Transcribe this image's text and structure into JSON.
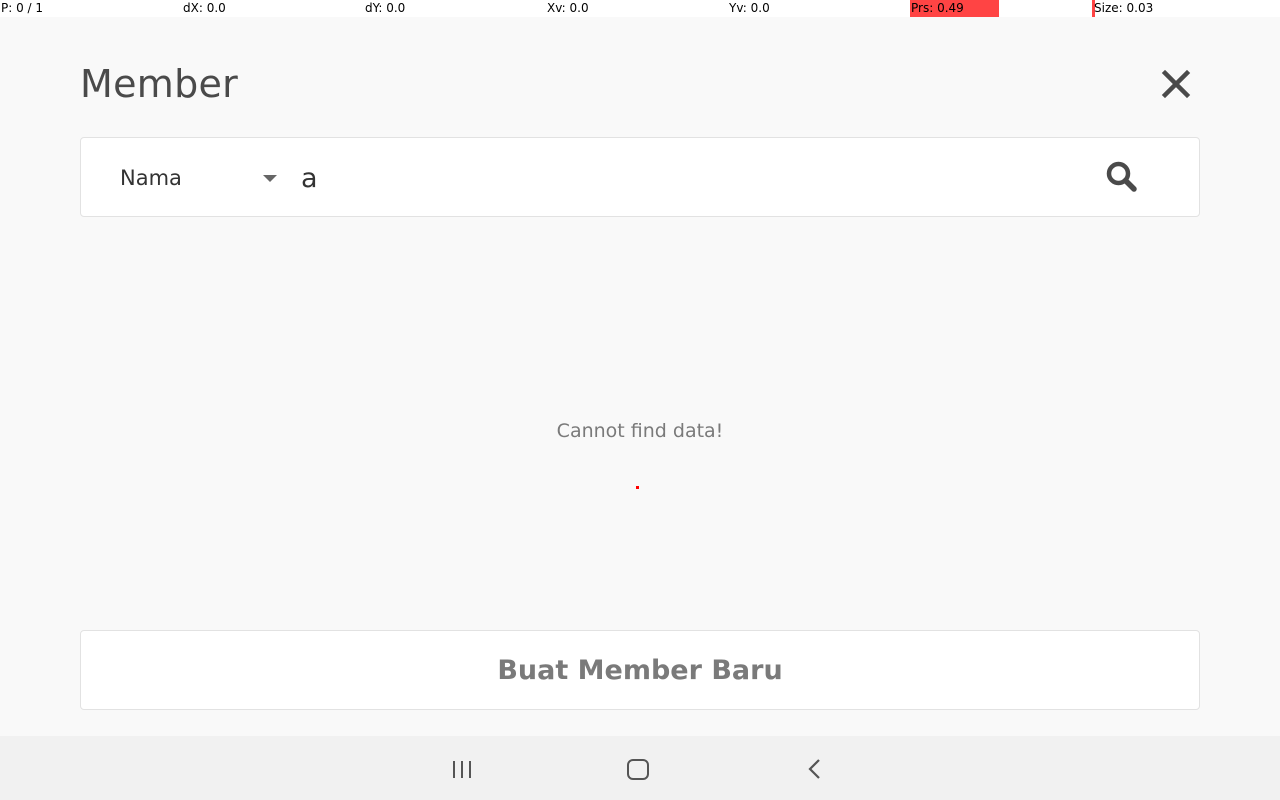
{
  "debug_bar": {
    "pointer": "P: 0 / 1",
    "dx": "dX: 0.0",
    "dy": "dY: 0.0",
    "xv": "Xv: 0.0",
    "yv": "Yv: 0.0",
    "prs": "Prs: 0.49",
    "size": "Size: 0.03",
    "highlight_color": "#ff4444"
  },
  "header": {
    "title": "Member",
    "close_icon": "close-icon"
  },
  "search": {
    "filter_selected": "Nama",
    "query_value": "a",
    "search_icon": "search-icon"
  },
  "results": {
    "empty_message": "Cannot find data!"
  },
  "actions": {
    "create_label": "Buat Member Baru"
  },
  "nav_bar": {
    "recents_icon": "recents-icon",
    "home_icon": "home-icon",
    "back_icon": "back-icon"
  }
}
